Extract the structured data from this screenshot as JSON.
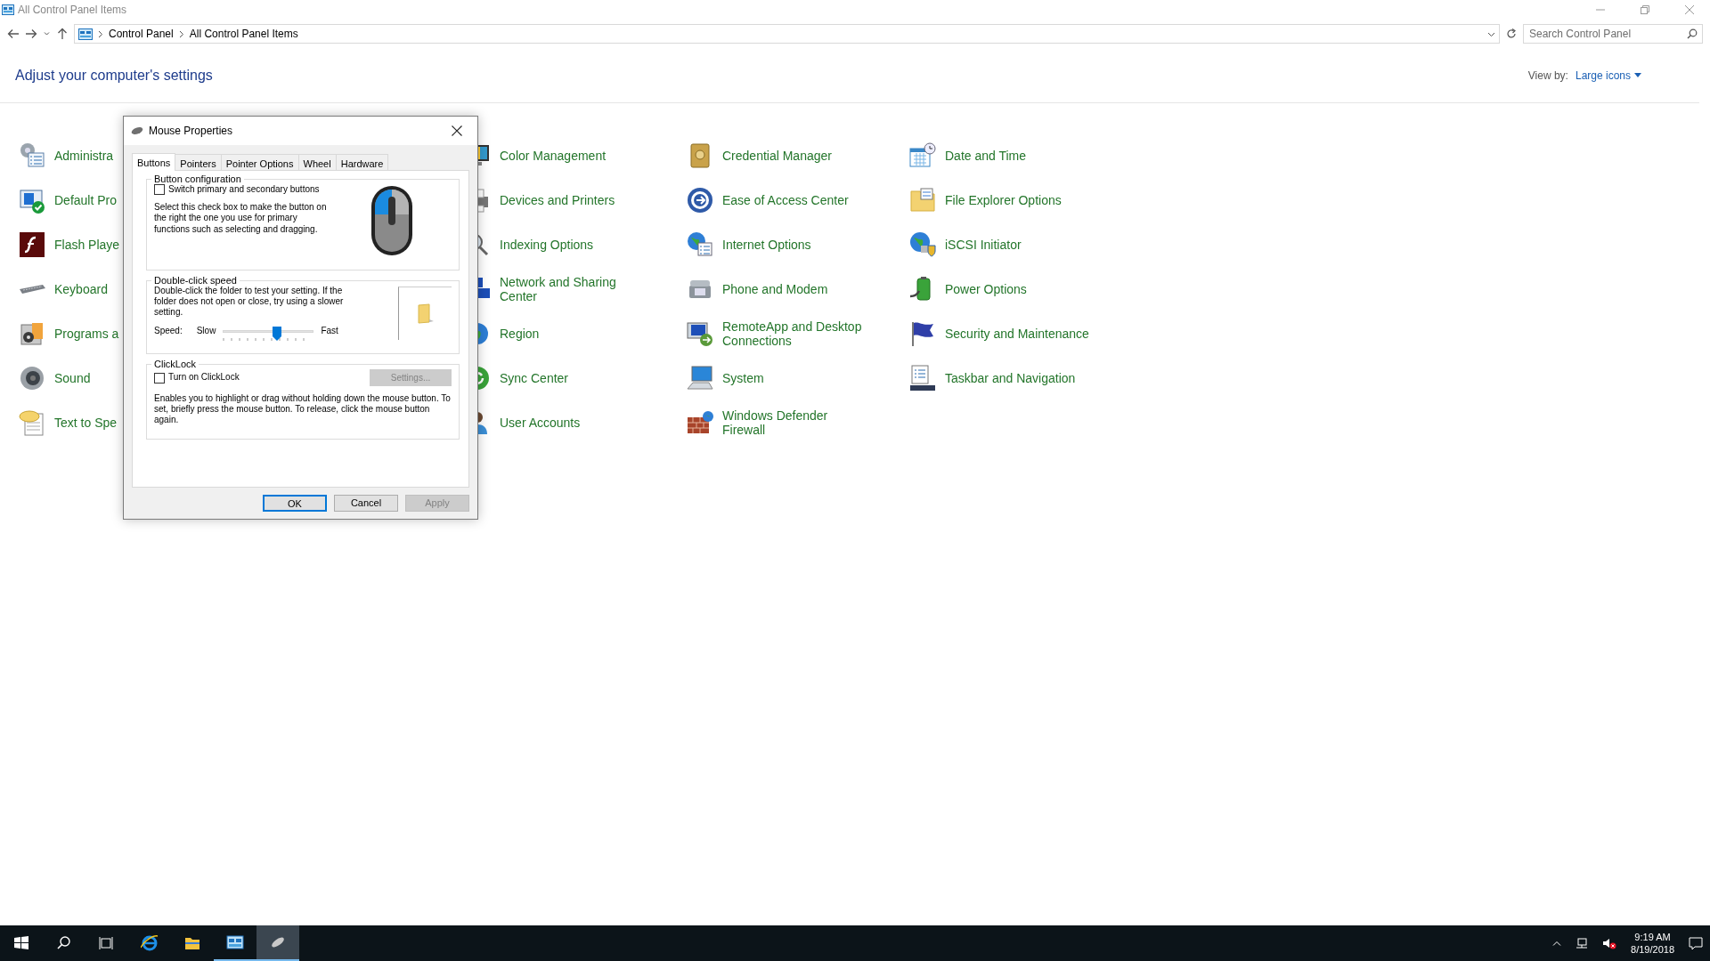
{
  "window": {
    "title": "All Control Panel Items"
  },
  "address_bar": {
    "breadcrumbs": [
      "Control Panel",
      "All Control Panel Items"
    ]
  },
  "search": {
    "placeholder": "Search Control Panel"
  },
  "heading": "Adjust your computer's settings",
  "view_by": {
    "label": "View by:",
    "value": "Large icons"
  },
  "rows": [
    [
      "Administra",
      "Color Management",
      "Credential Manager",
      "Date and Time"
    ],
    [
      "Default Pro",
      "Devices and Printers",
      "Ease of Access Center",
      "File Explorer Options"
    ],
    [
      "Flash Playe",
      "Indexing Options",
      "Internet Options",
      "iSCSI Initiator"
    ],
    [
      "Keyboard",
      "Network and Sharing Center",
      "Phone and Modem",
      "Power Options"
    ],
    [
      "Programs a",
      "Region",
      "RemoteApp and Desktop Connections",
      "Security and Maintenance"
    ],
    [
      "Sound",
      "Sync Center",
      "System",
      "Taskbar and Navigation"
    ],
    [
      "Text to Spe",
      "User Accounts",
      "Windows Defender Firewall"
    ]
  ],
  "dialog": {
    "title": "Mouse Properties",
    "tabs": [
      {
        "label": "Buttons",
        "selected": true
      },
      {
        "label": "Pointers",
        "selected": false
      },
      {
        "label": "Pointer Options",
        "selected": false
      },
      {
        "label": "Wheel",
        "selected": false
      },
      {
        "label": "Hardware",
        "selected": false
      }
    ],
    "button_configuration": {
      "title": "Button configuration",
      "checkbox": {
        "label": "Switch primary and secondary buttons",
        "checked": false
      },
      "description": "Select this check box to make the button on the right the one you use for primary functions such as selecting and dragging."
    },
    "double_click": {
      "title": "Double-click speed",
      "description": "Double-click the folder to test your setting. If the folder does not open or close, try using a slower setting.",
      "speed_label": "Speed:",
      "slow": "Slow",
      "fast": "Fast",
      "level": 0.59
    },
    "clicklock": {
      "title": "ClickLock",
      "checkbox": {
        "label": "Turn on ClickLock",
        "checked": false
      },
      "settings_button": {
        "label": "Settings...",
        "disabled": true
      },
      "description": "Enables you to highlight or drag without holding down the mouse button. To set, briefly press the mouse button. To release, click the mouse button again."
    },
    "buttons": [
      {
        "label": "OK",
        "default": true,
        "disabled": false
      },
      {
        "label": "Cancel",
        "default": false,
        "disabled": false
      },
      {
        "label": "Apply",
        "default": false,
        "disabled": true
      }
    ]
  },
  "taskbar": {
    "apps": [
      {
        "running": false,
        "selected": false
      },
      {
        "running": false,
        "selected": false
      },
      {
        "running": true,
        "selected": false
      },
      {
        "running": true,
        "selected": true
      }
    ],
    "clock": {
      "time": "9:19 AM",
      "date": "8/19/2018"
    }
  }
}
